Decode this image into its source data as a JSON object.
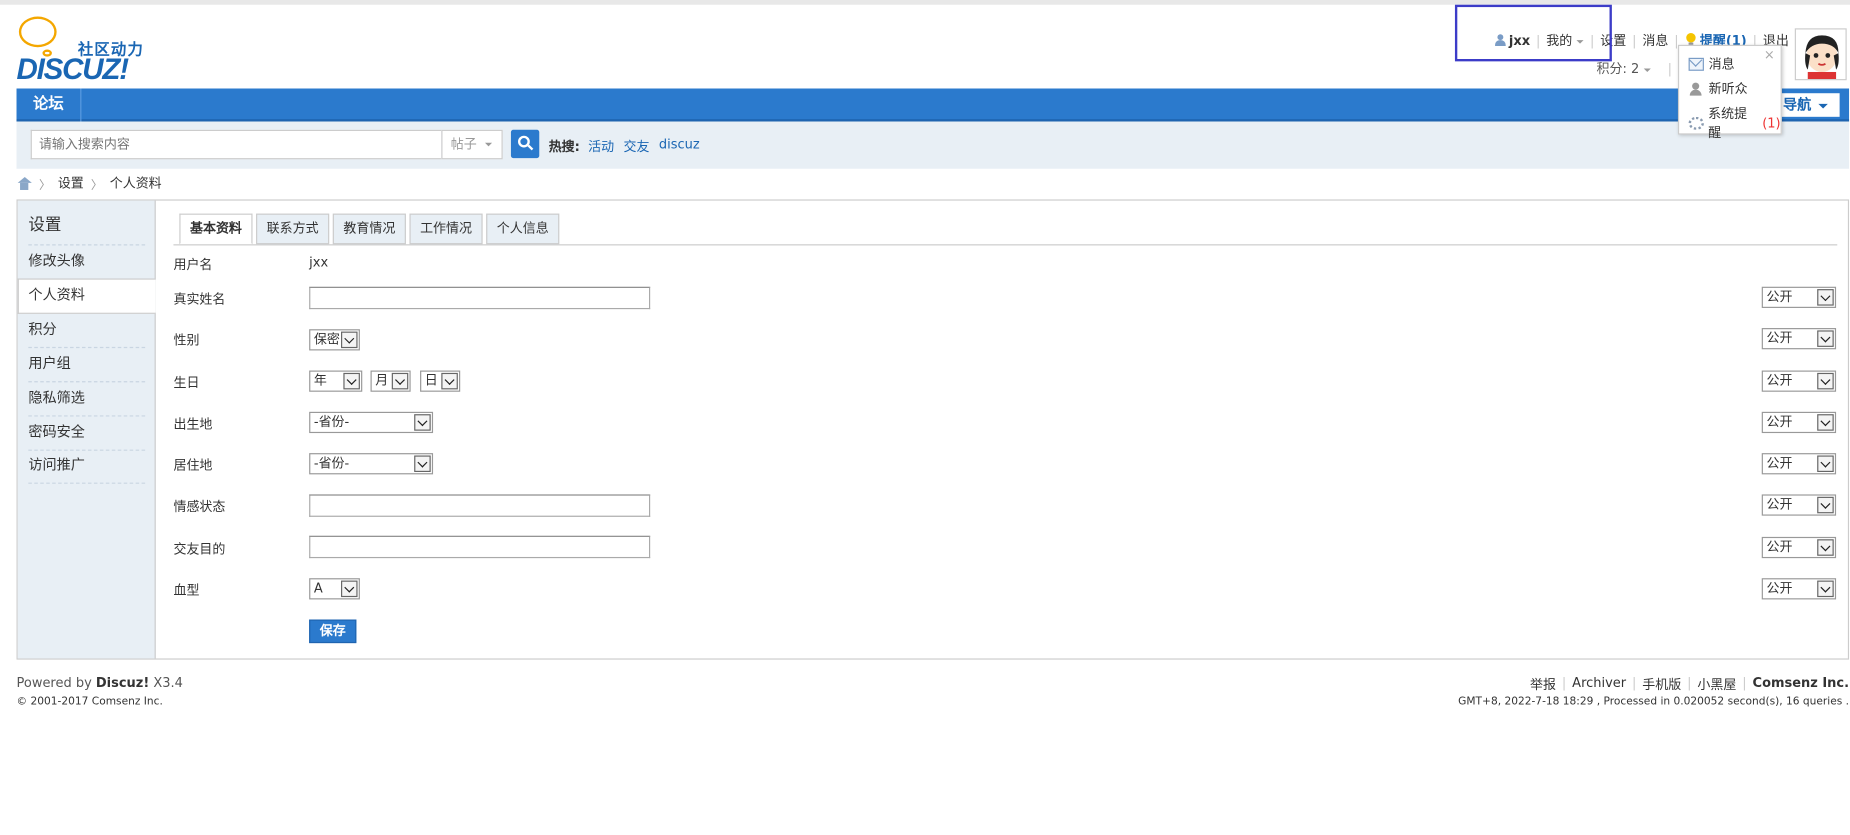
{
  "header": {
    "logo_sub": "社区动力",
    "logo_brand": "DISCUZ!",
    "user": {
      "username": "jxx",
      "my_label": "我的",
      "settings": "设置",
      "messages": "消息",
      "remind": "提醒(1)",
      "logout": "退出"
    },
    "credits": "积分: 2"
  },
  "notice_popup": {
    "close": "×",
    "items": [
      {
        "label": "消息",
        "count": ""
      },
      {
        "label": "新听众",
        "count": ""
      },
      {
        "label": "系统提醒",
        "count": "(1)"
      }
    ]
  },
  "nav": {
    "forum": "论坛",
    "quick_nav": "导航"
  },
  "search": {
    "placeholder": "请输入搜索内容",
    "type": "帖子",
    "hot_label": "热搜:",
    "hot_links": [
      "活动",
      "交友",
      "discuz"
    ]
  },
  "breadcrumb": {
    "items": [
      "设置",
      "个人资料"
    ]
  },
  "sidebar": {
    "title": "设置",
    "items": [
      {
        "label": "修改头像"
      },
      {
        "label": "个人资料"
      },
      {
        "label": "积分"
      },
      {
        "label": "用户组"
      },
      {
        "label": "隐私筛选"
      },
      {
        "label": "密码安全"
      },
      {
        "label": "访问推广"
      }
    ]
  },
  "tabs": [
    "基本资料",
    "联系方式",
    "教育情况",
    "工作情况",
    "个人信息"
  ],
  "form": {
    "username_label": "用户名",
    "username_value": "jxx",
    "realname_label": "真实姓名",
    "gender_label": "性别",
    "gender_value": "保密",
    "birthday_label": "生日",
    "birth_year": "年",
    "birth_month": "月",
    "birth_day": "日",
    "birthplace_label": "出生地",
    "birthplace_value": "-省份-",
    "residence_label": "居住地",
    "residence_value": "-省份-",
    "affective_label": "情感状态",
    "lookingfor_label": "交友目的",
    "bloodtype_label": "血型",
    "bloodtype_value": "A",
    "privacy_value": "公开",
    "save": "保存"
  },
  "footer": {
    "powered": "Powered by",
    "brand": "Discuz!",
    "version": "X3.4",
    "copyright": "© 2001-2017 Comsenz Inc.",
    "links": [
      "举报",
      "Archiver",
      "手机版",
      "小黑屋"
    ],
    "company": "Comsenz Inc.",
    "stats": "GMT+8, 2022-7-18 18:29 , Processed in 0.020052 second(s), 16 queries ."
  }
}
